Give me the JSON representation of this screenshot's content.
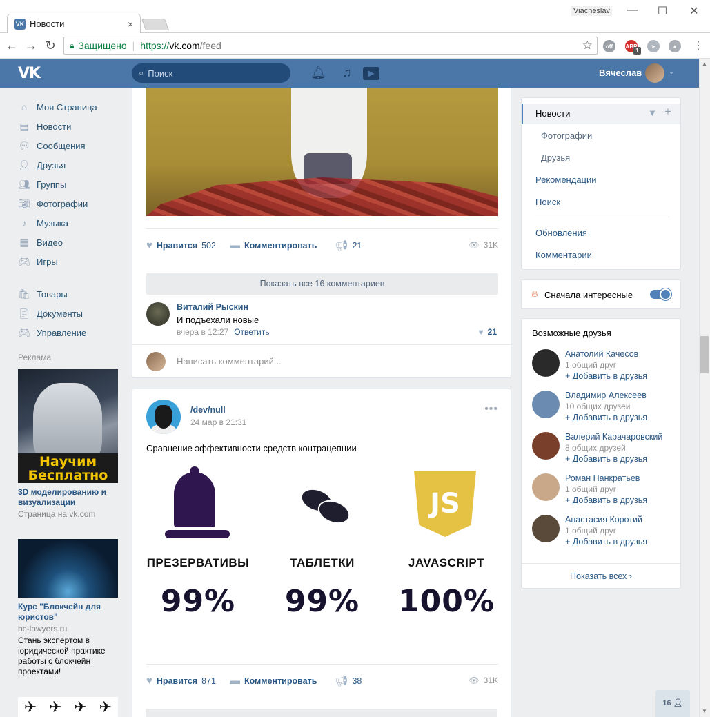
{
  "browser": {
    "tab_title": "Новости",
    "tab_favicon": "vk-icon",
    "tab_close": "×",
    "profile_name": "Viacheslav",
    "win_min": "—",
    "win_max": "☐",
    "win_close": "✕",
    "secure_label": "Защищено",
    "url_protocol": "https://",
    "url_host": "vk.com",
    "url_path": "/feed",
    "ext_abp_badge": "1"
  },
  "header": {
    "logo": "VK",
    "search_placeholder": "Поиск",
    "user_name": "Вячеслав",
    "accent_color": "#4a76a8"
  },
  "left_nav": {
    "items": [
      {
        "label": "Моя Страница",
        "icon": "home-icon"
      },
      {
        "label": "Новости",
        "icon": "news-icon"
      },
      {
        "label": "Сообщения",
        "icon": "messages-icon"
      },
      {
        "label": "Друзья",
        "icon": "friends-icon"
      },
      {
        "label": "Группы",
        "icon": "groups-icon"
      },
      {
        "label": "Фотографии",
        "icon": "photos-icon"
      },
      {
        "label": "Музыка",
        "icon": "music-icon"
      },
      {
        "label": "Видео",
        "icon": "video-icon"
      },
      {
        "label": "Игры",
        "icon": "games-icon"
      }
    ],
    "items2": [
      {
        "label": "Товары",
        "icon": "goods-icon"
      },
      {
        "label": "Документы",
        "icon": "documents-icon"
      },
      {
        "label": "Управление",
        "icon": "manage-icon"
      }
    ],
    "ads_label": "Реклама"
  },
  "ads": {
    "ad1_image_text": "Научим Бесплатно",
    "ad1_title": "3D моделированию и визуализации",
    "ad1_sub": "Страница на vk.com",
    "ad2_title": "Курс \"Блокчейн для юристов\"",
    "ad2_sub": "bc-lawyers.ru",
    "ad2_desc": "Стань экспертом в юридической практике работы с блокчейн проектами!"
  },
  "post1": {
    "like_label": "Нравится",
    "like_count": "502",
    "comment_label": "Комментировать",
    "share_count": "21",
    "views": "31K",
    "show_all_comments": "Показать все 16 комментариев",
    "comment": {
      "author": "Виталий Рыскин",
      "text": "И подъехали новые",
      "time": "вчера в 12:27",
      "reply": "Ответить",
      "likes": "21"
    },
    "write_placeholder": "Написать комментарий..."
  },
  "post2": {
    "author": "/dev/null",
    "date": "24 мар в 21:31",
    "text": "Сравнение эффективности средств контрацепции",
    "infographic": [
      {
        "label": "ПРЕЗЕРВАТИВЫ",
        "value": "99%"
      },
      {
        "label": "ТАБЛЕТКИ",
        "value": "99%"
      },
      {
        "label": "JAVASCRIPT",
        "value": "100%",
        "logo": "JS"
      }
    ],
    "like_label": "Нравится",
    "like_count": "871",
    "comment_label": "Комментировать",
    "share_count": "38",
    "views": "31K"
  },
  "right_menu": {
    "active": "Новости",
    "items": [
      {
        "label": "Фотографии",
        "sub": true
      },
      {
        "label": "Друзья",
        "sub": true
      },
      {
        "label": "Рекомендации",
        "sub": false
      },
      {
        "label": "Поиск",
        "sub": false
      },
      {
        "label": "Обновления",
        "sub": false
      },
      {
        "label": "Комментарии",
        "sub": false
      }
    ]
  },
  "interesting": {
    "label": "Сначала интересные",
    "enabled": true
  },
  "possible_friends": {
    "title": "Возможные друзья",
    "add_label": "+ Добавить в друзья",
    "show_all": "Показать всех",
    "people": [
      {
        "name": "Анатолий Качесов",
        "mutual": "1 общий друг",
        "color": "#2a2a2a"
      },
      {
        "name": "Владимир Алексеев",
        "mutual": "10 общих друзей",
        "color": "#6b8bb0"
      },
      {
        "name": "Валерий Карачаровский",
        "mutual": "8 общих друзей",
        "color": "#7a3f2a"
      },
      {
        "name": "Роман Панкратьев",
        "mutual": "1 общий друг",
        "color": "#c9a88a"
      },
      {
        "name": "Анастасия Коротий",
        "mutual": "1 общий друг",
        "color": "#5a4a3a"
      }
    ]
  },
  "online_count": "16"
}
